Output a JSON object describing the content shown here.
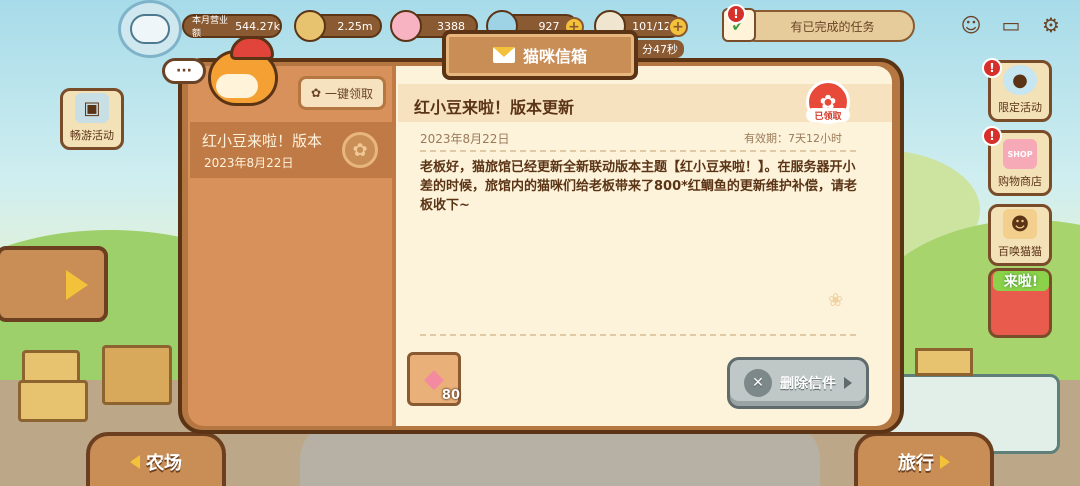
{
  "hud": {
    "business_label": "本月营业额",
    "business_value": "544.27k",
    "coins": "2.25m",
    "fish": "3388",
    "gems": "927",
    "stamina": "101/120",
    "timer": "分47秒"
  },
  "tasks": {
    "label": "有已完成的任务"
  },
  "side_left": {
    "travel_event": "畅游活动"
  },
  "side_right": {
    "limited_event": "限定活动",
    "shop": "购物商店",
    "shop_sign": "SHOP",
    "summon": "百唤猫猫",
    "coming": "来啦!"
  },
  "bottom": {
    "farm": "农场",
    "travel": "旅行"
  },
  "mailbox": {
    "title": "猫咪信箱",
    "claim_all": "一键领取",
    "bubble": "···",
    "list": [
      {
        "title": "红小豆来啦！版本",
        "date": "2023年8月22日"
      }
    ],
    "detail": {
      "title": "红小豆来啦！版本更新",
      "date": "2023年8月22日",
      "expiry": "有效期：7天12小时",
      "claimed_label": "已领取",
      "body": "老板好，猫旅馆已经更新全新联动版本主题【红小豆来啦！】。在服务器开小差的时候，旅馆内的猫咪们给老板带来了800*红鲷鱼的更新维护补偿，请老板收下~",
      "reward_count": "80",
      "delete_label": "删除信件"
    }
  },
  "colors": {
    "frame": "#b57742",
    "frame_border": "#5b3416",
    "paper": "#fdf3da",
    "list_bg": "#d8915a",
    "accent_yellow": "#f4c13a",
    "stamp_red": "#e84a3a"
  }
}
